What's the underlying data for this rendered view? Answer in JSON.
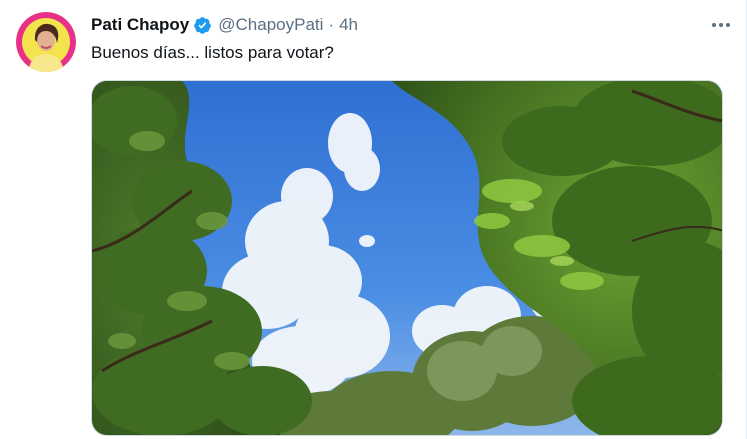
{
  "tweet": {
    "author_name": "Pati Chapoy",
    "handle": "@ChapoyPati",
    "separator": "·",
    "time": "4h",
    "text": "Buenos días... listos para votar?",
    "verified_icon": "verified-badge-icon",
    "more_icon": "more-options-icon"
  },
  "colors": {
    "verified": "#1d9bf0",
    "secondary_text": "#5b7083",
    "primary_text": "#0f1419",
    "sky": "#3b7fd9"
  }
}
